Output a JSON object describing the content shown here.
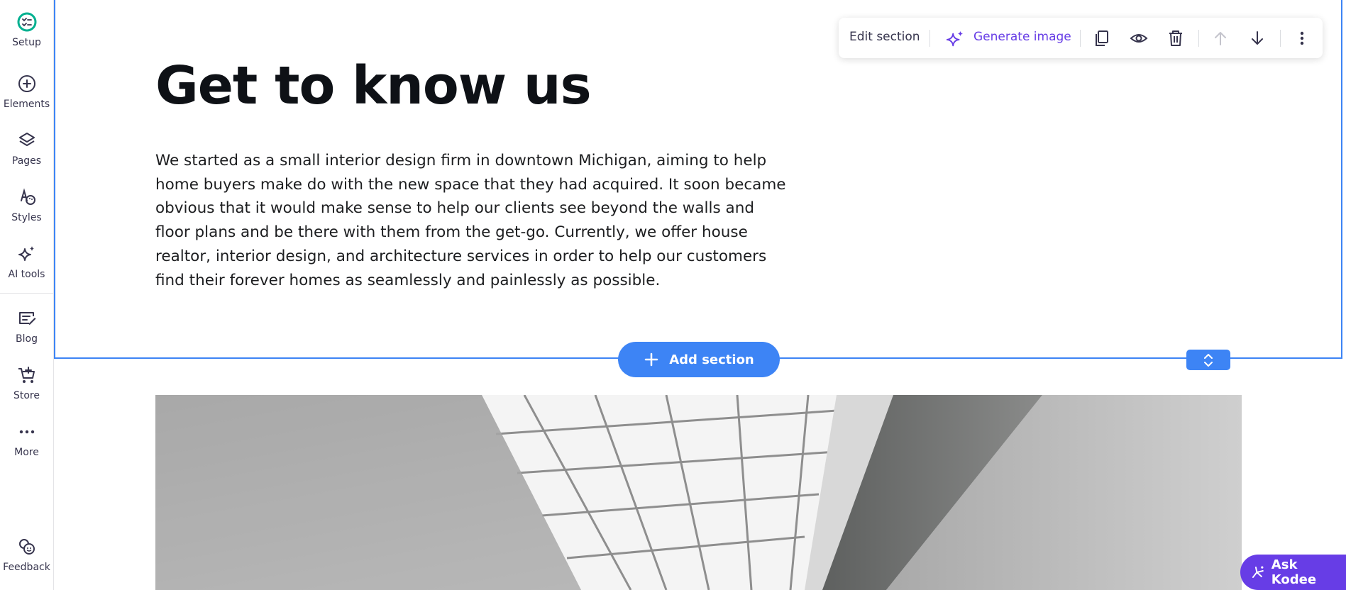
{
  "sidebar": {
    "items": [
      {
        "label": "Setup",
        "icon": "setup-checklist-icon"
      },
      {
        "label": "Elements",
        "icon": "plus-circle-icon"
      },
      {
        "label": "Pages",
        "icon": "layers-icon"
      },
      {
        "label": "Styles",
        "icon": "palette-icon"
      },
      {
        "label": "AI tools",
        "icon": "sparkles-icon"
      },
      {
        "label": "Blog",
        "icon": "blog-edit-icon"
      },
      {
        "label": "Store",
        "icon": "cart-icon"
      },
      {
        "label": "More",
        "icon": "more-horizontal-icon"
      }
    ],
    "feedback": {
      "label": "Feedback",
      "icon": "feedback-icon"
    }
  },
  "toolbar": {
    "edit_label": "Edit section",
    "generate_label": "Generate image",
    "icons": [
      "duplicate-icon",
      "eye-icon",
      "trash-icon",
      "arrow-up-icon",
      "arrow-down-icon",
      "more-vertical-icon"
    ]
  },
  "section": {
    "title": "Get to know us",
    "body": "We started as a small interior design firm in downtown Michigan, aiming to help home buyers make do with the new space that they had acquired. It soon became obvious that it would make sense to help our clients see beyond the walls and floor plans and be there with them from the get-go. Currently, we offer house realtor, interior design, and architecture services in order to help our customers find their forever homes as seamlessly and painlessly as possible."
  },
  "add_section": {
    "label": "Add section"
  },
  "ask_kodee": {
    "label": "Ask Kodee"
  },
  "colors": {
    "accent_blue": "#3d84f5",
    "brand_purple": "#673de6",
    "setup_green": "#00b090"
  }
}
